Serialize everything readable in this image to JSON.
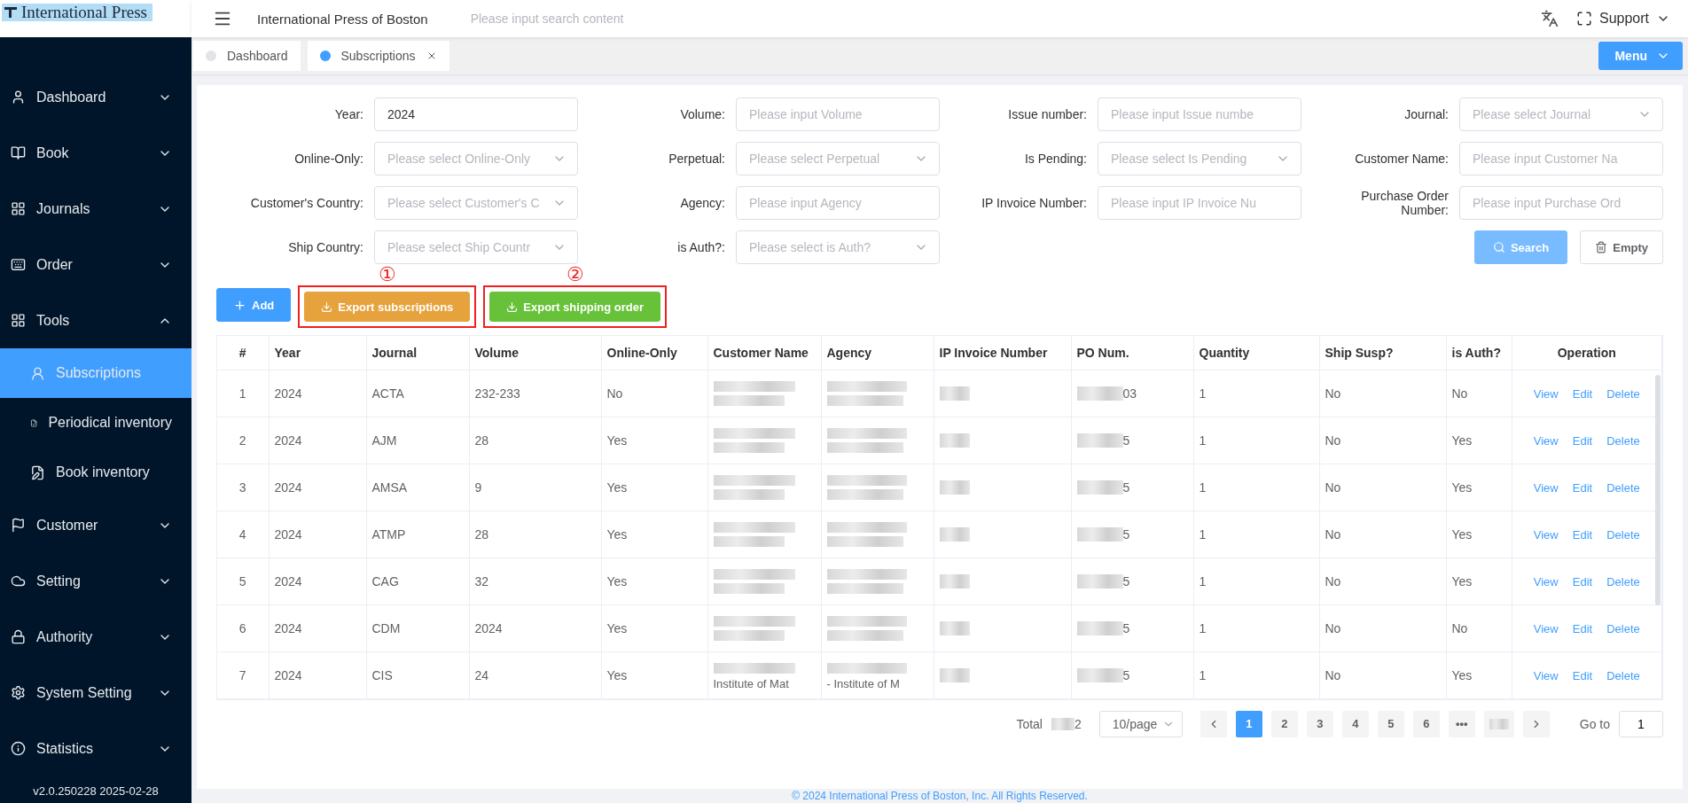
{
  "brand": {
    "logo_text": "International Press"
  },
  "sidebar": {
    "items": [
      {
        "label": "Dashboard",
        "expanded": false,
        "selected": false
      },
      {
        "label": "Book",
        "expanded": false,
        "selected": false
      },
      {
        "label": "Journals",
        "expanded": false,
        "selected": false
      },
      {
        "label": "Order",
        "expanded": false,
        "selected": false
      },
      {
        "label": "Tools",
        "expanded": true,
        "selected": false,
        "children": [
          {
            "label": "Subscriptions",
            "selected": true
          },
          {
            "label": "Periodical inventory",
            "selected": false
          },
          {
            "label": "Book inventory",
            "selected": false
          }
        ]
      },
      {
        "label": "Customer",
        "expanded": false,
        "selected": false
      },
      {
        "label": "Setting",
        "expanded": false,
        "selected": false
      },
      {
        "label": "Authority",
        "expanded": false,
        "selected": false
      },
      {
        "label": "System Setting",
        "expanded": false,
        "selected": false
      },
      {
        "label": "Statistics",
        "expanded": false,
        "selected": false
      }
    ],
    "version": "v2.0.250228 2025-02-28"
  },
  "header": {
    "title": "International Press of Boston",
    "search_placeholder": "Please input search content",
    "user_menu": "Support"
  },
  "tabs": [
    {
      "label": "Dashboard",
      "selected": false,
      "closable": false
    },
    {
      "label": "Subscriptions",
      "selected": true,
      "closable": true
    }
  ],
  "menu_button": "Menu",
  "filters": [
    {
      "label": "Year:",
      "kind": "input",
      "value": "2024"
    },
    {
      "label": "Volume:",
      "kind": "input",
      "placeholder": "Please input Volume"
    },
    {
      "label": "Issue number:",
      "kind": "input",
      "placeholder": "Please input Issue numbe"
    },
    {
      "label": "Journal:",
      "kind": "select",
      "placeholder": "Please select Journal"
    },
    {
      "label": "Online-Only:",
      "kind": "select",
      "placeholder": "Please select Online-Only"
    },
    {
      "label": "Perpetual:",
      "kind": "select",
      "placeholder": "Please select Perpetual"
    },
    {
      "label": "Is Pending:",
      "kind": "select",
      "placeholder": "Please select Is Pending"
    },
    {
      "label": "Customer Name:",
      "kind": "input",
      "placeholder": "Please input Customer Na"
    },
    {
      "label": "Customer's Country:",
      "kind": "select",
      "placeholder": "Please select Customer's C"
    },
    {
      "label": "Agency:",
      "kind": "input",
      "placeholder": "Please input Agency"
    },
    {
      "label": "IP Invoice Number:",
      "kind": "input",
      "placeholder": "Please input IP Invoice Nu"
    },
    {
      "label": "Purchase Order Number:",
      "kind": "input",
      "placeholder": "Please input Purchase Ord"
    },
    {
      "label": "Ship Country:",
      "kind": "select",
      "placeholder": "Please select Ship Countr"
    },
    {
      "label": "is Auth?:",
      "kind": "select",
      "placeholder": "Please select is Auth?"
    }
  ],
  "filter_actions": {
    "search": "Search",
    "empty": "Empty"
  },
  "toolbar": {
    "add": "Add",
    "exports": [
      {
        "label": "Export subscriptions",
        "marker": "①",
        "color": "#e6a23c"
      },
      {
        "label": "Export shipping order",
        "marker": "②",
        "color": "#67c23a"
      }
    ]
  },
  "table": {
    "columns": [
      "#",
      "Year",
      "Journal",
      "Volume",
      "Online-Only",
      "Customer Name",
      "Agency",
      "IP Invoice Number",
      "PO Num.",
      "Quantity",
      "Ship Susp?",
      "is Auth?",
      "Operation"
    ],
    "rows": [
      {
        "index": "1",
        "year": "2024",
        "journal": "ACTA",
        "volume": "232-233",
        "online_only": "No",
        "po_suffix": "03",
        "quantity": "1",
        "ship_susp": "No",
        "is_auth": "No",
        "actions": [
          "View",
          "Edit",
          "Delete"
        ]
      },
      {
        "index": "2",
        "year": "2024",
        "journal": "AJM",
        "volume": "28",
        "online_only": "Yes",
        "po_suffix": "5",
        "quantity": "1",
        "ship_susp": "No",
        "is_auth": "Yes",
        "actions": [
          "View",
          "Edit",
          "Delete"
        ]
      },
      {
        "index": "3",
        "year": "2024",
        "journal": "AMSA",
        "volume": "9",
        "online_only": "Yes",
        "po_suffix": "5",
        "quantity": "1",
        "ship_susp": "No",
        "is_auth": "Yes",
        "actions": [
          "View",
          "Edit",
          "Delete"
        ]
      },
      {
        "index": "4",
        "year": "2024",
        "journal": "ATMP",
        "volume": "28",
        "online_only": "Yes",
        "po_suffix": "5",
        "quantity": "1",
        "ship_susp": "No",
        "is_auth": "Yes",
        "actions": [
          "View",
          "Edit",
          "Delete"
        ]
      },
      {
        "index": "5",
        "year": "2024",
        "journal": "CAG",
        "volume": "32",
        "online_only": "Yes",
        "po_suffix": "5",
        "quantity": "1",
        "ship_susp": "No",
        "is_auth": "Yes",
        "actions": [
          "View",
          "Edit",
          "Delete"
        ]
      },
      {
        "index": "6",
        "year": "2024",
        "journal": "CDM",
        "volume": "2024",
        "online_only": "Yes",
        "po_suffix": "5",
        "quantity": "1",
        "ship_susp": "No",
        "is_auth": "No",
        "actions": [
          "View",
          "Edit",
          "Delete"
        ]
      },
      {
        "index": "7",
        "year": "2024",
        "journal": "CIS",
        "volume": "24",
        "online_only": "Yes",
        "po_suffix": "5",
        "quantity": "1",
        "ship_susp": "No",
        "is_auth": "Yes",
        "customer_tail": "Institute of Mat",
        "agency_tail": "- Institute of M",
        "actions": [
          "View",
          "Edit",
          "Delete"
        ]
      }
    ]
  },
  "pagination": {
    "total_label": "Total",
    "total_suffix": "2",
    "page_size": "10/page",
    "pages": [
      {
        "label": "1",
        "selected": true
      },
      {
        "label": "2",
        "selected": false
      },
      {
        "label": "3",
        "selected": false
      },
      {
        "label": "4",
        "selected": false
      },
      {
        "label": "5",
        "selected": false
      },
      {
        "label": "6",
        "selected": false
      },
      {
        "label": "•••",
        "selected": false
      }
    ],
    "goto_label": "Go to",
    "goto_value": "1"
  },
  "footer": "© 2024 International Press of Boston, Inc. All Rights Reserved."
}
